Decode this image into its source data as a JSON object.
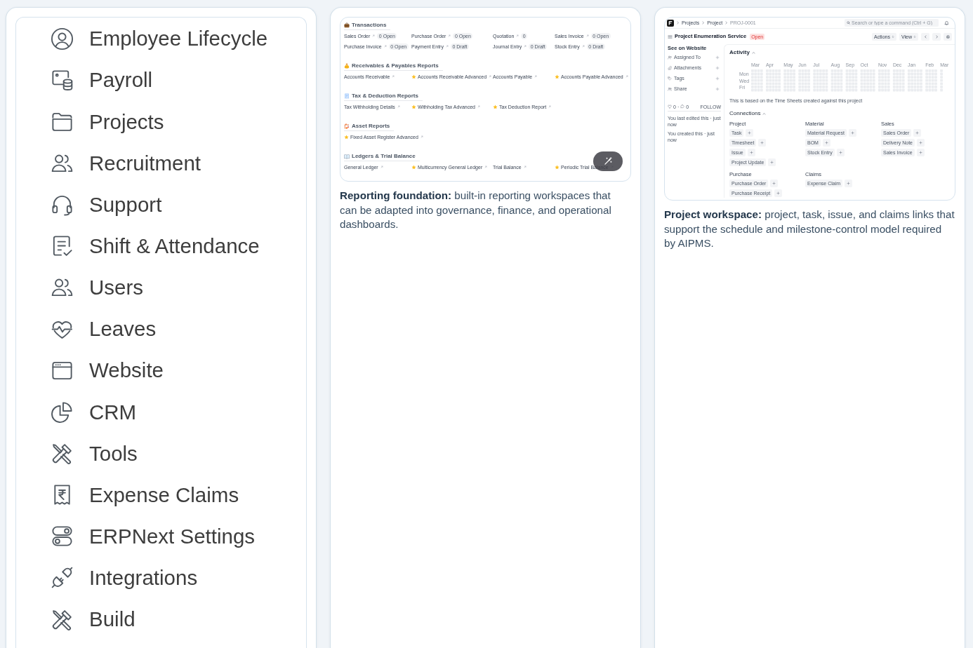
{
  "figures": [
    {
      "kind": "sidebar",
      "items": [
        {
          "label": "Employee Lifecycle"
        },
        {
          "label": "Payroll"
        },
        {
          "label": "Projects"
        },
        {
          "label": "Recruitment"
        },
        {
          "label": "Support"
        },
        {
          "label": "Shift & Attendance"
        },
        {
          "label": "Users"
        },
        {
          "label": "Leaves"
        },
        {
          "label": "Website"
        },
        {
          "label": "CRM"
        },
        {
          "label": "Tools"
        },
        {
          "label": "Expense Claims"
        },
        {
          "label": "ERPNext Settings"
        },
        {
          "label": "Integrations"
        },
        {
          "label": "Build"
        }
      ]
    },
    {
      "kind": "reports_workspace",
      "sections": [
        {
          "title": "Transactions",
          "links": [
            {
              "label": "Sales Order",
              "starred": false,
              "badge": "0 Open"
            },
            {
              "label": "Purchase Order",
              "starred": false,
              "badge": "0 Open"
            },
            {
              "label": "Quotation",
              "starred": false,
              "badge": "0"
            },
            {
              "label": "Sales Invoice",
              "starred": false,
              "badge": "0 Open"
            },
            {
              "label": "Purchase Invoice",
              "starred": false,
              "badge": "0 Open"
            },
            {
              "label": "Payment Entry",
              "starred": false,
              "badge": "0 Draft"
            },
            {
              "label": "Journal Entry",
              "starred": false,
              "badge": "0 Draft"
            },
            {
              "label": "Stock Entry",
              "starred": false,
              "badge": "0 Draft"
            }
          ]
        },
        {
          "title": "Receivables & Payables Reports",
          "links": [
            {
              "label": "Accounts Receivable",
              "starred": false
            },
            {
              "label": "Accounts Receivable Advanced",
              "starred": true
            },
            {
              "label": "Accounts Payable",
              "starred": false
            },
            {
              "label": "Accounts Payable Advanced",
              "starred": true
            }
          ]
        },
        {
          "title": "Tax & Deduction Reports",
          "links": [
            {
              "label": "Tax Withholding Details",
              "starred": false
            },
            {
              "label": "Withholding Tax Advanced",
              "starred": true
            },
            {
              "label": "Tax Deduction Report",
              "starred": true
            }
          ]
        },
        {
          "title": "Asset Reports",
          "links": [
            {
              "label": "Fixed Asset Register Advanced",
              "starred": true
            }
          ]
        },
        {
          "title": "Ledgers & Trial Balance",
          "links": [
            {
              "label": "General Ledger",
              "starred": false
            },
            {
              "label": "Multicurrency General Ledger",
              "starred": true
            },
            {
              "label": "Trial Balance",
              "starred": false
            },
            {
              "label": "Periodic Trial Balance",
              "starred": true
            }
          ]
        }
      ],
      "caption": "**Reporting foundation:** built-in reporting workspaces that can be adapted into governance, finance, and operational dashboards."
    },
    {
      "kind": "project_form",
      "navbar": {
        "breadcrumbs": [
          "Projects",
          "Project",
          "PROJ-0001"
        ],
        "search": {
          "placeholder": "Search or type a command (Ctrl + G)"
        }
      },
      "header": {
        "title": "Project Enumeration Service",
        "status": "Open",
        "menus": [
          "Actions",
          "View"
        ]
      },
      "sidebar": {
        "website_link": "See on Website",
        "items": [
          {
            "label": "Assigned To"
          },
          {
            "label": "Attachments"
          },
          {
            "label": "Tags"
          },
          {
            "label": "Share"
          }
        ],
        "likes": "0",
        "separator": "·",
        "comments": "0",
        "follow": "FOLLOW",
        "timeline": [
          "You last edited this · just now",
          "You created this · just now"
        ]
      },
      "activity": {
        "title": "Activity",
        "month_labels": [
          "Mar",
          "Apr",
          "May",
          "Jun",
          "Jul",
          "Aug",
          "Sep",
          "Oct",
          "Nov",
          "Dec",
          "Jan",
          "Feb",
          "Mar"
        ],
        "day_labels": [
          "Mon",
          "Wed",
          "Fri"
        ],
        "note": "This is based on the Time Sheets created against this project"
      },
      "connections": {
        "title": "Connections",
        "groups": [
          {
            "title": "Project",
            "items": [
              "Task",
              "Timesheet",
              "Issue",
              "Project Update"
            ]
          },
          {
            "title": "Material",
            "items": [
              "Material Request",
              "BOM",
              "Stock Entry"
            ]
          },
          {
            "title": "Sales",
            "items": [
              "Sales Order",
              "Delivery Note",
              "Sales Invoice"
            ]
          },
          {
            "title": "Purchase",
            "items": [
              "Purchase Order",
              "Purchase Receipt"
            ]
          },
          {
            "title": "Claims",
            "items": [
              "Expense Claim"
            ]
          }
        ]
      },
      "caption": "**Project workspace:** project, task, issue, and claims links that support the schedule and milestone-control model required by AIPMS."
    }
  ]
}
